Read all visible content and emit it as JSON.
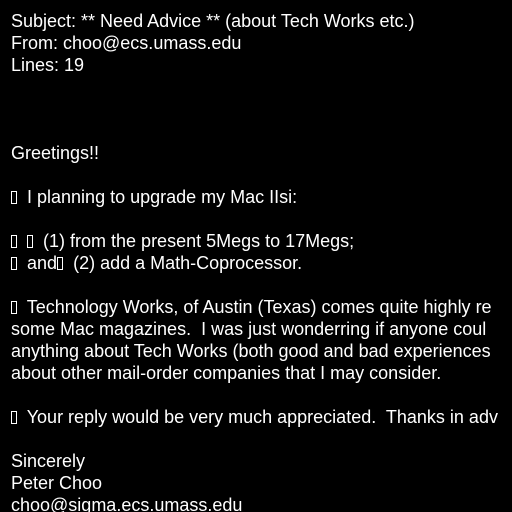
{
  "email": {
    "header": {
      "subject_line": "Subject: ** Need Advice ** (about Tech Works etc.)",
      "from_line": "From: choo@ecs.umass.edu",
      "lines_line": "Lines: 19"
    },
    "body": {
      "greeting": "Greetings!!",
      "upgrade_intro": "I planning to upgrade my Mac IIsi:",
      "step_1": "(1) from the present 5Megs to 17Megs;",
      "step_2_prefix": "and",
      "step_2": "(2) add a Math-Coprocessor.",
      "paragraph_line_1": "Technology Works, of Austin (Texas) comes quite highly re",
      "paragraph_line_2": "some Mac magazines.  I was just wonderring if anyone coul",
      "paragraph_line_3": "anything about Tech Works (both good and bad experiences",
      "paragraph_line_4": "about other mail-order companies that I may consider.",
      "reply_line": "Your reply would be very much appreciated.  Thanks in adv"
    },
    "signature": {
      "closing": "Sincerely",
      "name": "Peter Choo",
      "address": "choo@sigma.ecs.umass.edu"
    }
  }
}
